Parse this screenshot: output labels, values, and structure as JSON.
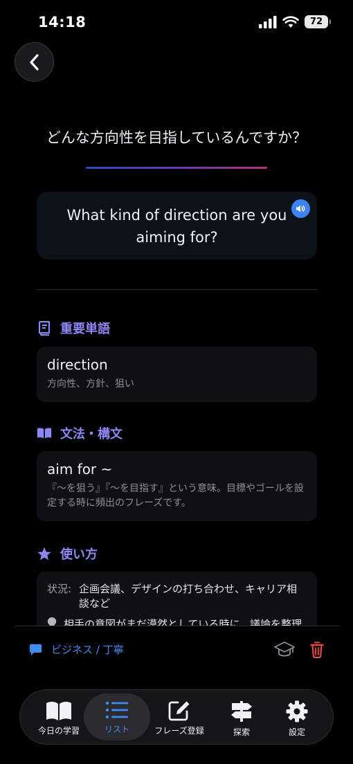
{
  "status": {
    "time": "14:18",
    "battery": "72"
  },
  "question_jp": "どんな方向性を目指しているんですか？",
  "question_en": "What kind of direction are you aiming for?",
  "sections": {
    "vocab": {
      "title": "重要単語",
      "word": "direction",
      "meaning": "方向性、方針、狙い"
    },
    "grammar": {
      "title": "文法・構文",
      "pattern": "aim for ~",
      "explanation": "『〜を狙う』『〜を目指す』という意味。目標やゴールを設定する時に頻出のフレーズです。"
    },
    "usage": {
      "title": "使い方",
      "situation_label": "状況:",
      "situation": "企画会議、デザインの打ち合わせ、キャリア相談など",
      "tip": "相手の意図がまだ漠然としている時に、議論を整理"
    }
  },
  "tag": "ビジネス / 丁寧",
  "tabs": [
    {
      "label": "今日の学習",
      "icon": "book-open-icon",
      "active": false
    },
    {
      "label": "リスト",
      "icon": "list-icon",
      "active": true
    },
    {
      "label": "フレーズ登録",
      "icon": "edit-icon",
      "active": false
    },
    {
      "label": "探索",
      "icon": "signpost-icon",
      "active": false
    },
    {
      "label": "設定",
      "icon": "gear-icon",
      "active": false
    }
  ],
  "colors": {
    "accent": "#3d8ef7",
    "section": "#8b87f5",
    "danger": "#ff453a"
  }
}
